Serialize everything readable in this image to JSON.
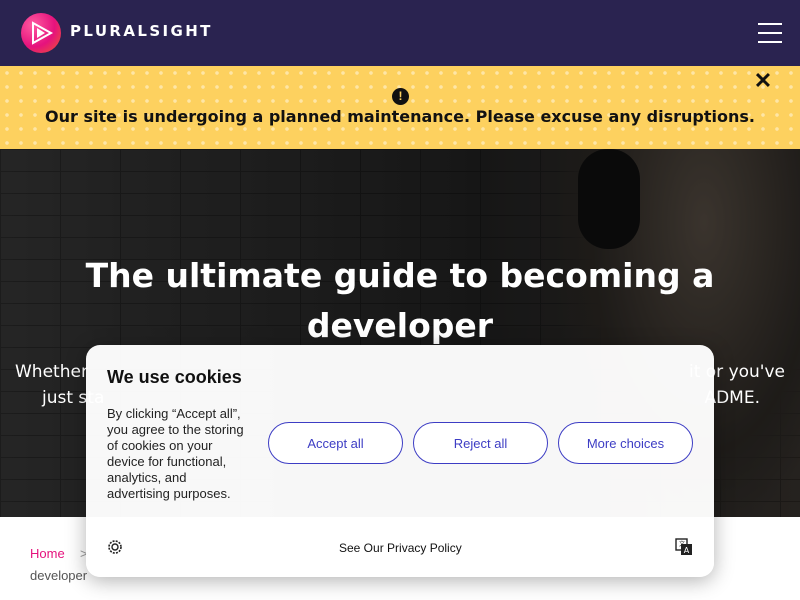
{
  "header": {
    "brand": "PLURALSIGHT",
    "logo_icon": "play-logo-icon",
    "menu_icon": "hamburger-menu-icon"
  },
  "banner": {
    "icon": "alert-icon",
    "icon_glyph": "!",
    "message": "Our site is undergoing a planned maintenance. Please excuse any disruptions.",
    "close_glyph": "✕",
    "color": "#fdd15f"
  },
  "hero": {
    "title": "The ultimate guide to becoming a developer",
    "subtitle_start": "Whether",
    "subtitle_end": "it or you've",
    "subtitle_line2_start": "just sta",
    "subtitle_line2_end": "ADME."
  },
  "breadcrumb": {
    "home": "Home",
    "separator": ">",
    "current": "developer"
  },
  "cookie_dialog": {
    "title": "We use cookies",
    "body": "By clicking “Accept all”, you agree to the storing of cookies on your device for functional, analytics, and advertising purposes.",
    "accept_label": "Accept all",
    "reject_label": "Reject all",
    "more_label": "More choices",
    "policy_link": "See Our Privacy Policy",
    "settings_icon": "cookie-settings-icon",
    "language_icon": "language-icon",
    "accent": "#3d3dc4"
  }
}
